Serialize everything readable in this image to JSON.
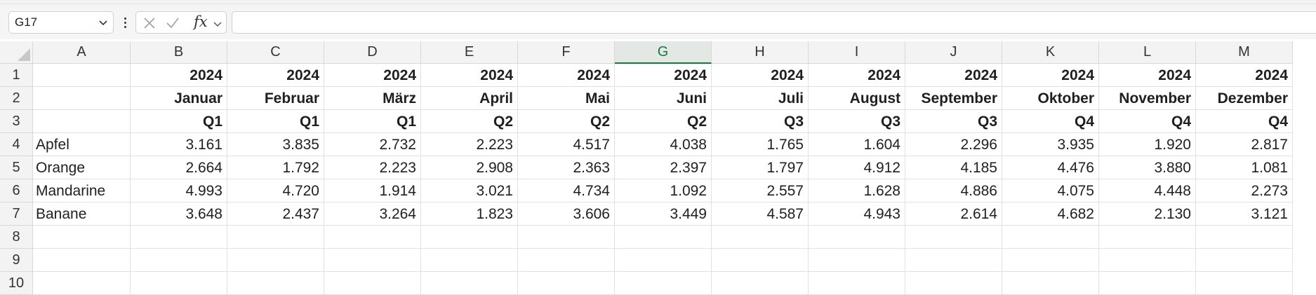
{
  "formula_bar": {
    "name_box": "G17",
    "formula": ""
  },
  "icons": {
    "cancel": "close-icon",
    "confirm": "check-icon",
    "function": "fx-icon"
  },
  "fx_label": "fx",
  "colors": {
    "selected_header": "#107c41",
    "header_bg": "#f3f3f3",
    "gridline": "#e1e1e1"
  },
  "columns": [
    "A",
    "B",
    "C",
    "D",
    "E",
    "F",
    "G",
    "H",
    "I",
    "J",
    "K",
    "L",
    "M"
  ],
  "selected_column": "G",
  "rows": [
    {
      "num": "1",
      "cells": [
        "",
        "2024",
        "2024",
        "2024",
        "2024",
        "2024",
        "2024",
        "2024",
        "2024",
        "2024",
        "2024",
        "2024",
        "2024"
      ]
    },
    {
      "num": "2",
      "cells": [
        "",
        "Januar",
        "Februar",
        "März",
        "April",
        "Mai",
        "Juni",
        "Juli",
        "August",
        "September",
        "Oktober",
        "November",
        "Dezember"
      ]
    },
    {
      "num": "3",
      "cells": [
        "",
        "Q1",
        "Q1",
        "Q1",
        "Q2",
        "Q2",
        "Q2",
        "Q3",
        "Q3",
        "Q3",
        "Q4",
        "Q4",
        "Q4"
      ]
    },
    {
      "num": "4",
      "cells": [
        "Apfel",
        "3.161",
        "3.835",
        "2.732",
        "2.223",
        "4.517",
        "4.038",
        "1.765",
        "1.604",
        "2.296",
        "3.935",
        "1.920",
        "2.817"
      ]
    },
    {
      "num": "5",
      "cells": [
        "Orange",
        "2.664",
        "1.792",
        "2.223",
        "2.908",
        "2.363",
        "2.397",
        "1.797",
        "4.912",
        "4.185",
        "4.476",
        "3.880",
        "1.081"
      ]
    },
    {
      "num": "6",
      "cells": [
        "Mandarine",
        "4.993",
        "4.720",
        "1.914",
        "3.021",
        "4.734",
        "1.092",
        "2.557",
        "1.628",
        "4.886",
        "4.075",
        "4.448",
        "2.273"
      ]
    },
    {
      "num": "7",
      "cells": [
        "Banane",
        "3.648",
        "2.437",
        "3.264",
        "1.823",
        "3.606",
        "3.449",
        "4.587",
        "4.943",
        "2.614",
        "4.682",
        "2.130",
        "3.121"
      ]
    },
    {
      "num": "8",
      "cells": [
        "",
        "",
        "",
        "",
        "",
        "",
        "",
        "",
        "",
        "",
        "",
        "",
        ""
      ]
    },
    {
      "num": "9",
      "cells": [
        "",
        "",
        "",
        "",
        "",
        "",
        "",
        "",
        "",
        "",
        "",
        "",
        ""
      ]
    },
    {
      "num": "10",
      "cells": [
        "",
        "",
        "",
        "",
        "",
        "",
        "",
        "",
        "",
        "",
        "",
        "",
        ""
      ]
    }
  ]
}
